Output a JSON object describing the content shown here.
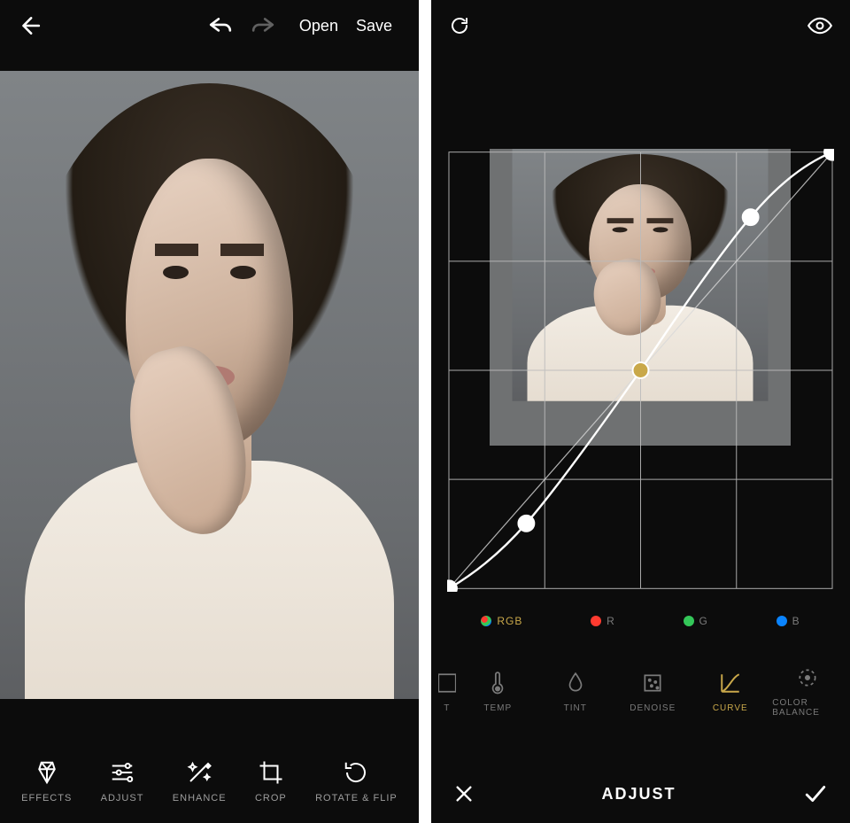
{
  "left": {
    "topbar": {
      "open_label": "Open",
      "save_label": "Save"
    },
    "tools": [
      {
        "id": "effects",
        "label": "EFFECTS"
      },
      {
        "id": "adjust",
        "label": "ADJUST"
      },
      {
        "id": "enhance",
        "label": "ENHANCE"
      },
      {
        "id": "crop",
        "label": "CROP"
      },
      {
        "id": "rotateflip",
        "label": "ROTATE & FLIP"
      }
    ]
  },
  "right": {
    "channels": [
      {
        "id": "rgb",
        "label": "RGB",
        "active": true
      },
      {
        "id": "r",
        "label": "R",
        "active": false
      },
      {
        "id": "g",
        "label": "G",
        "active": false
      },
      {
        "id": "b",
        "label": "B",
        "active": false
      }
    ],
    "adjust_tools": [
      {
        "id": "partial",
        "label": "T"
      },
      {
        "id": "temp",
        "label": "TEMP"
      },
      {
        "id": "tint",
        "label": "TINT"
      },
      {
        "id": "denoise",
        "label": "DENOISE"
      },
      {
        "id": "curve",
        "label": "CURVE",
        "active": true
      },
      {
        "id": "colorbalance",
        "label": "COLOR BALANCE"
      }
    ],
    "confirm_title": "ADJUST",
    "curve_points": [
      {
        "x": 0.0,
        "y": 0.0
      },
      {
        "x": 0.2,
        "y": 0.15
      },
      {
        "x": 0.5,
        "y": 0.5
      },
      {
        "x": 0.78,
        "y": 0.85
      },
      {
        "x": 1.0,
        "y": 1.0
      }
    ]
  }
}
